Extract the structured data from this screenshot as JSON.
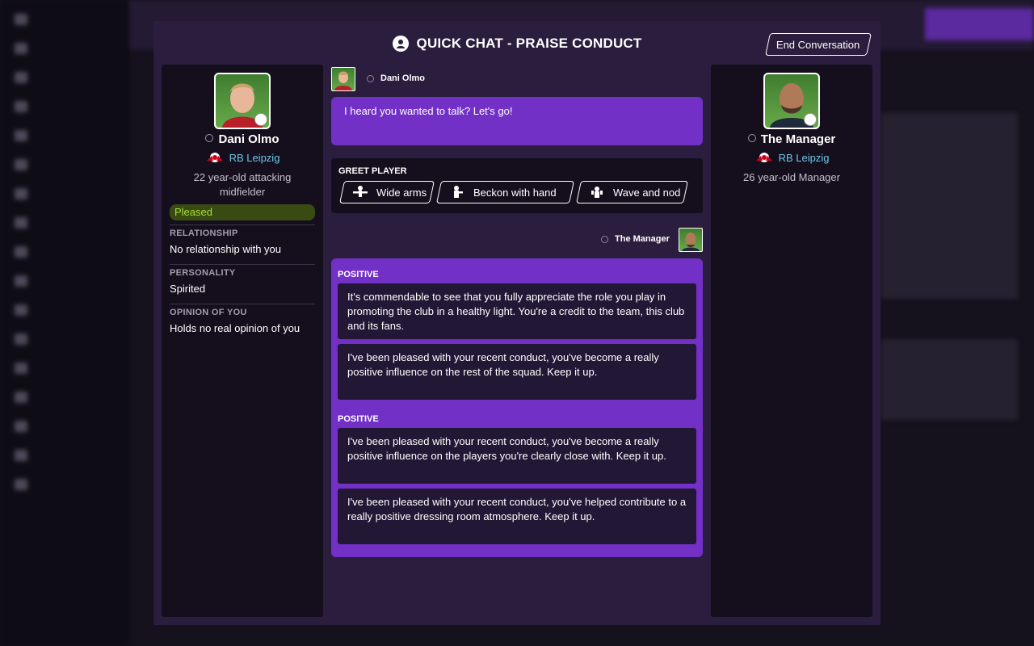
{
  "modal": {
    "title": "QUICK CHAT - PRAISE CONDUCT",
    "end_button": "End Conversation"
  },
  "player": {
    "name": "Dani Olmo",
    "club": "RB Leipzig",
    "description": "22 year-old attacking midfielder",
    "mood": "Pleased",
    "relationship_label": "RELATIONSHIP",
    "relationship_value": "No relationship with you",
    "personality_label": "PERSONALITY",
    "personality_value": "Spirited",
    "opinion_label": "OPINION OF YOU",
    "opinion_value": "Holds no real opinion of you"
  },
  "manager": {
    "name": "The Manager",
    "club": "RB Leipzig",
    "description": "26 year-old Manager"
  },
  "chat": {
    "player_speaker": "Dani Olmo",
    "player_message": "I heard you wanted to talk? Let's go!",
    "greet_label": "GREET PLAYER",
    "greet_options": [
      "Wide arms",
      "Beckon with hand",
      "Wave and nod"
    ],
    "manager_speaker": "The Manager",
    "categories": [
      "POSITIVE",
      "POSITIVE"
    ],
    "responses": [
      "It's commendable to see that you fully appreciate the role you play in promoting the club in a healthy light. You're a credit to the team, this club and its fans.",
      "I've been pleased with your recent conduct, you've become a really positive influence on the rest of the squad. Keep it up.",
      "I've been pleased with your recent conduct, you've become a really positive influence on the players you're clearly close with. Keep it up.",
      "I've been pleased with your recent conduct, you've helped contribute to a really positive dressing room atmosphere. Keep it up."
    ]
  },
  "colors": {
    "modal_bg": "#2a1d3e",
    "panel_bg": "#150f1d",
    "accent_purple": "#7230c6",
    "club_link": "#6dc7e8",
    "mood_text": "#a5e03a"
  }
}
